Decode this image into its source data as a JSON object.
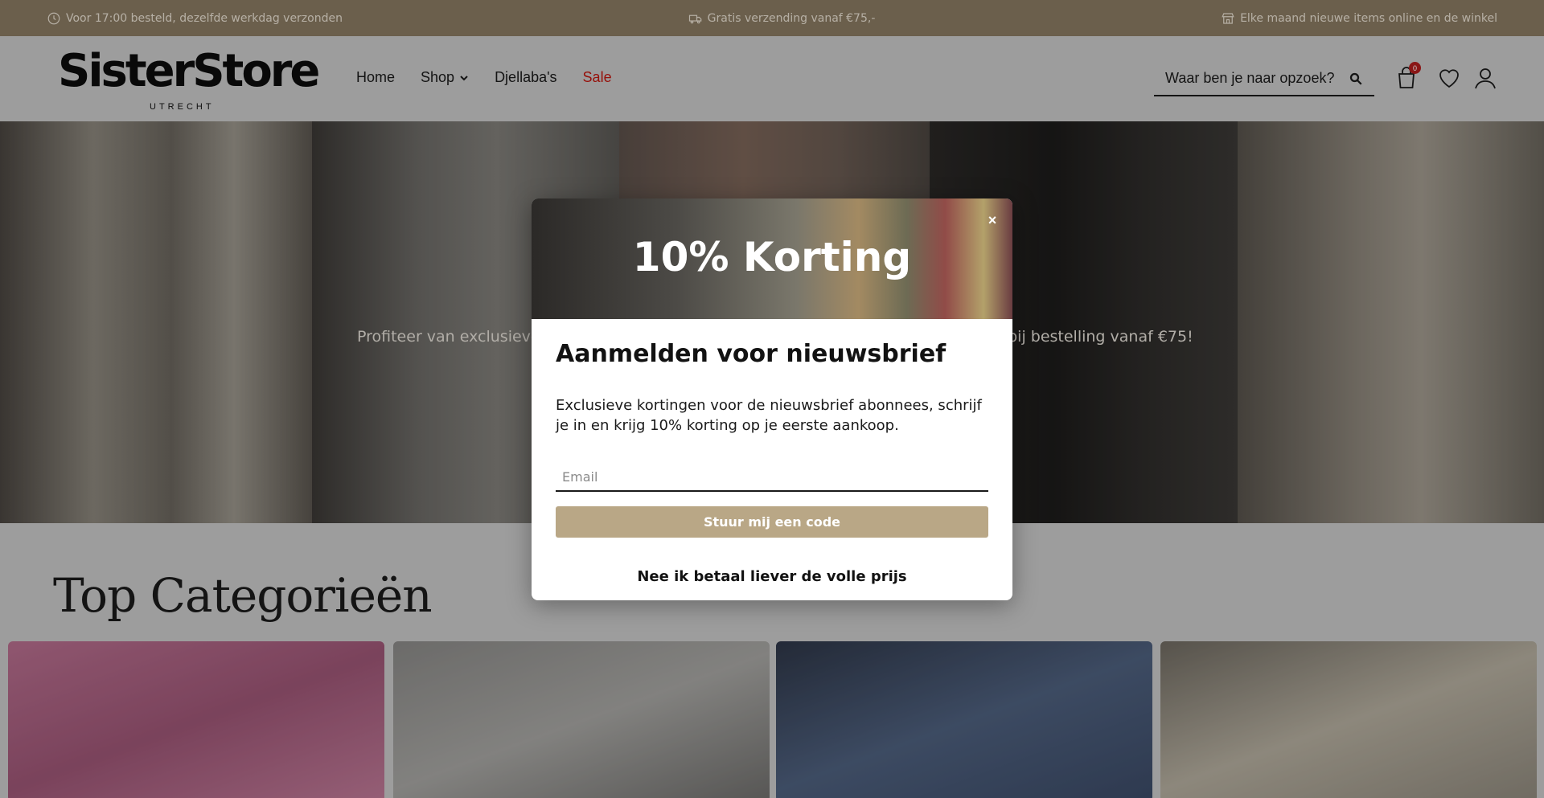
{
  "topbar": {
    "left": "Voor 17:00 besteld, dezelfde werkdag verzonden",
    "center": "Gratis verzending vanaf €75,-",
    "right": "Elke maand nieuwe items online en de winkel",
    "left_icon": "clock-icon",
    "center_icon": "truck-icon",
    "right_icon": "store-icon"
  },
  "header": {
    "logo_main": "SisterStore",
    "logo_sub": "UTRECHT",
    "nav": [
      {
        "label": "Home"
      },
      {
        "label": "Shop"
      },
      {
        "label": "Djellaba's"
      },
      {
        "label": "Sale"
      }
    ],
    "search_placeholder": "Waar ben je naar opzoek?",
    "cart_count": "0"
  },
  "hero": {
    "text_left": "Profiteer van exclusieve ko",
    "text_right": "g bij bestelling vanaf €75!"
  },
  "categories": {
    "title": "Top Categorieën"
  },
  "modal": {
    "title": "10% Korting",
    "heading": "Aanmelden voor nieuwsbrief",
    "body": "Exclusieve kortingen voor de nieuwsbrief abonnees, schrijf je in en krijg 10% korting op je eerste aankoop.",
    "email_placeholder": "Email",
    "submit_label": "Stuur mij een code",
    "decline_label": "Nee ik betaal liever de volle prijs",
    "close_label": "×"
  },
  "colors": {
    "topbar": "#8a7a62",
    "accent": "#b9a786",
    "sale": "#c0160f"
  }
}
